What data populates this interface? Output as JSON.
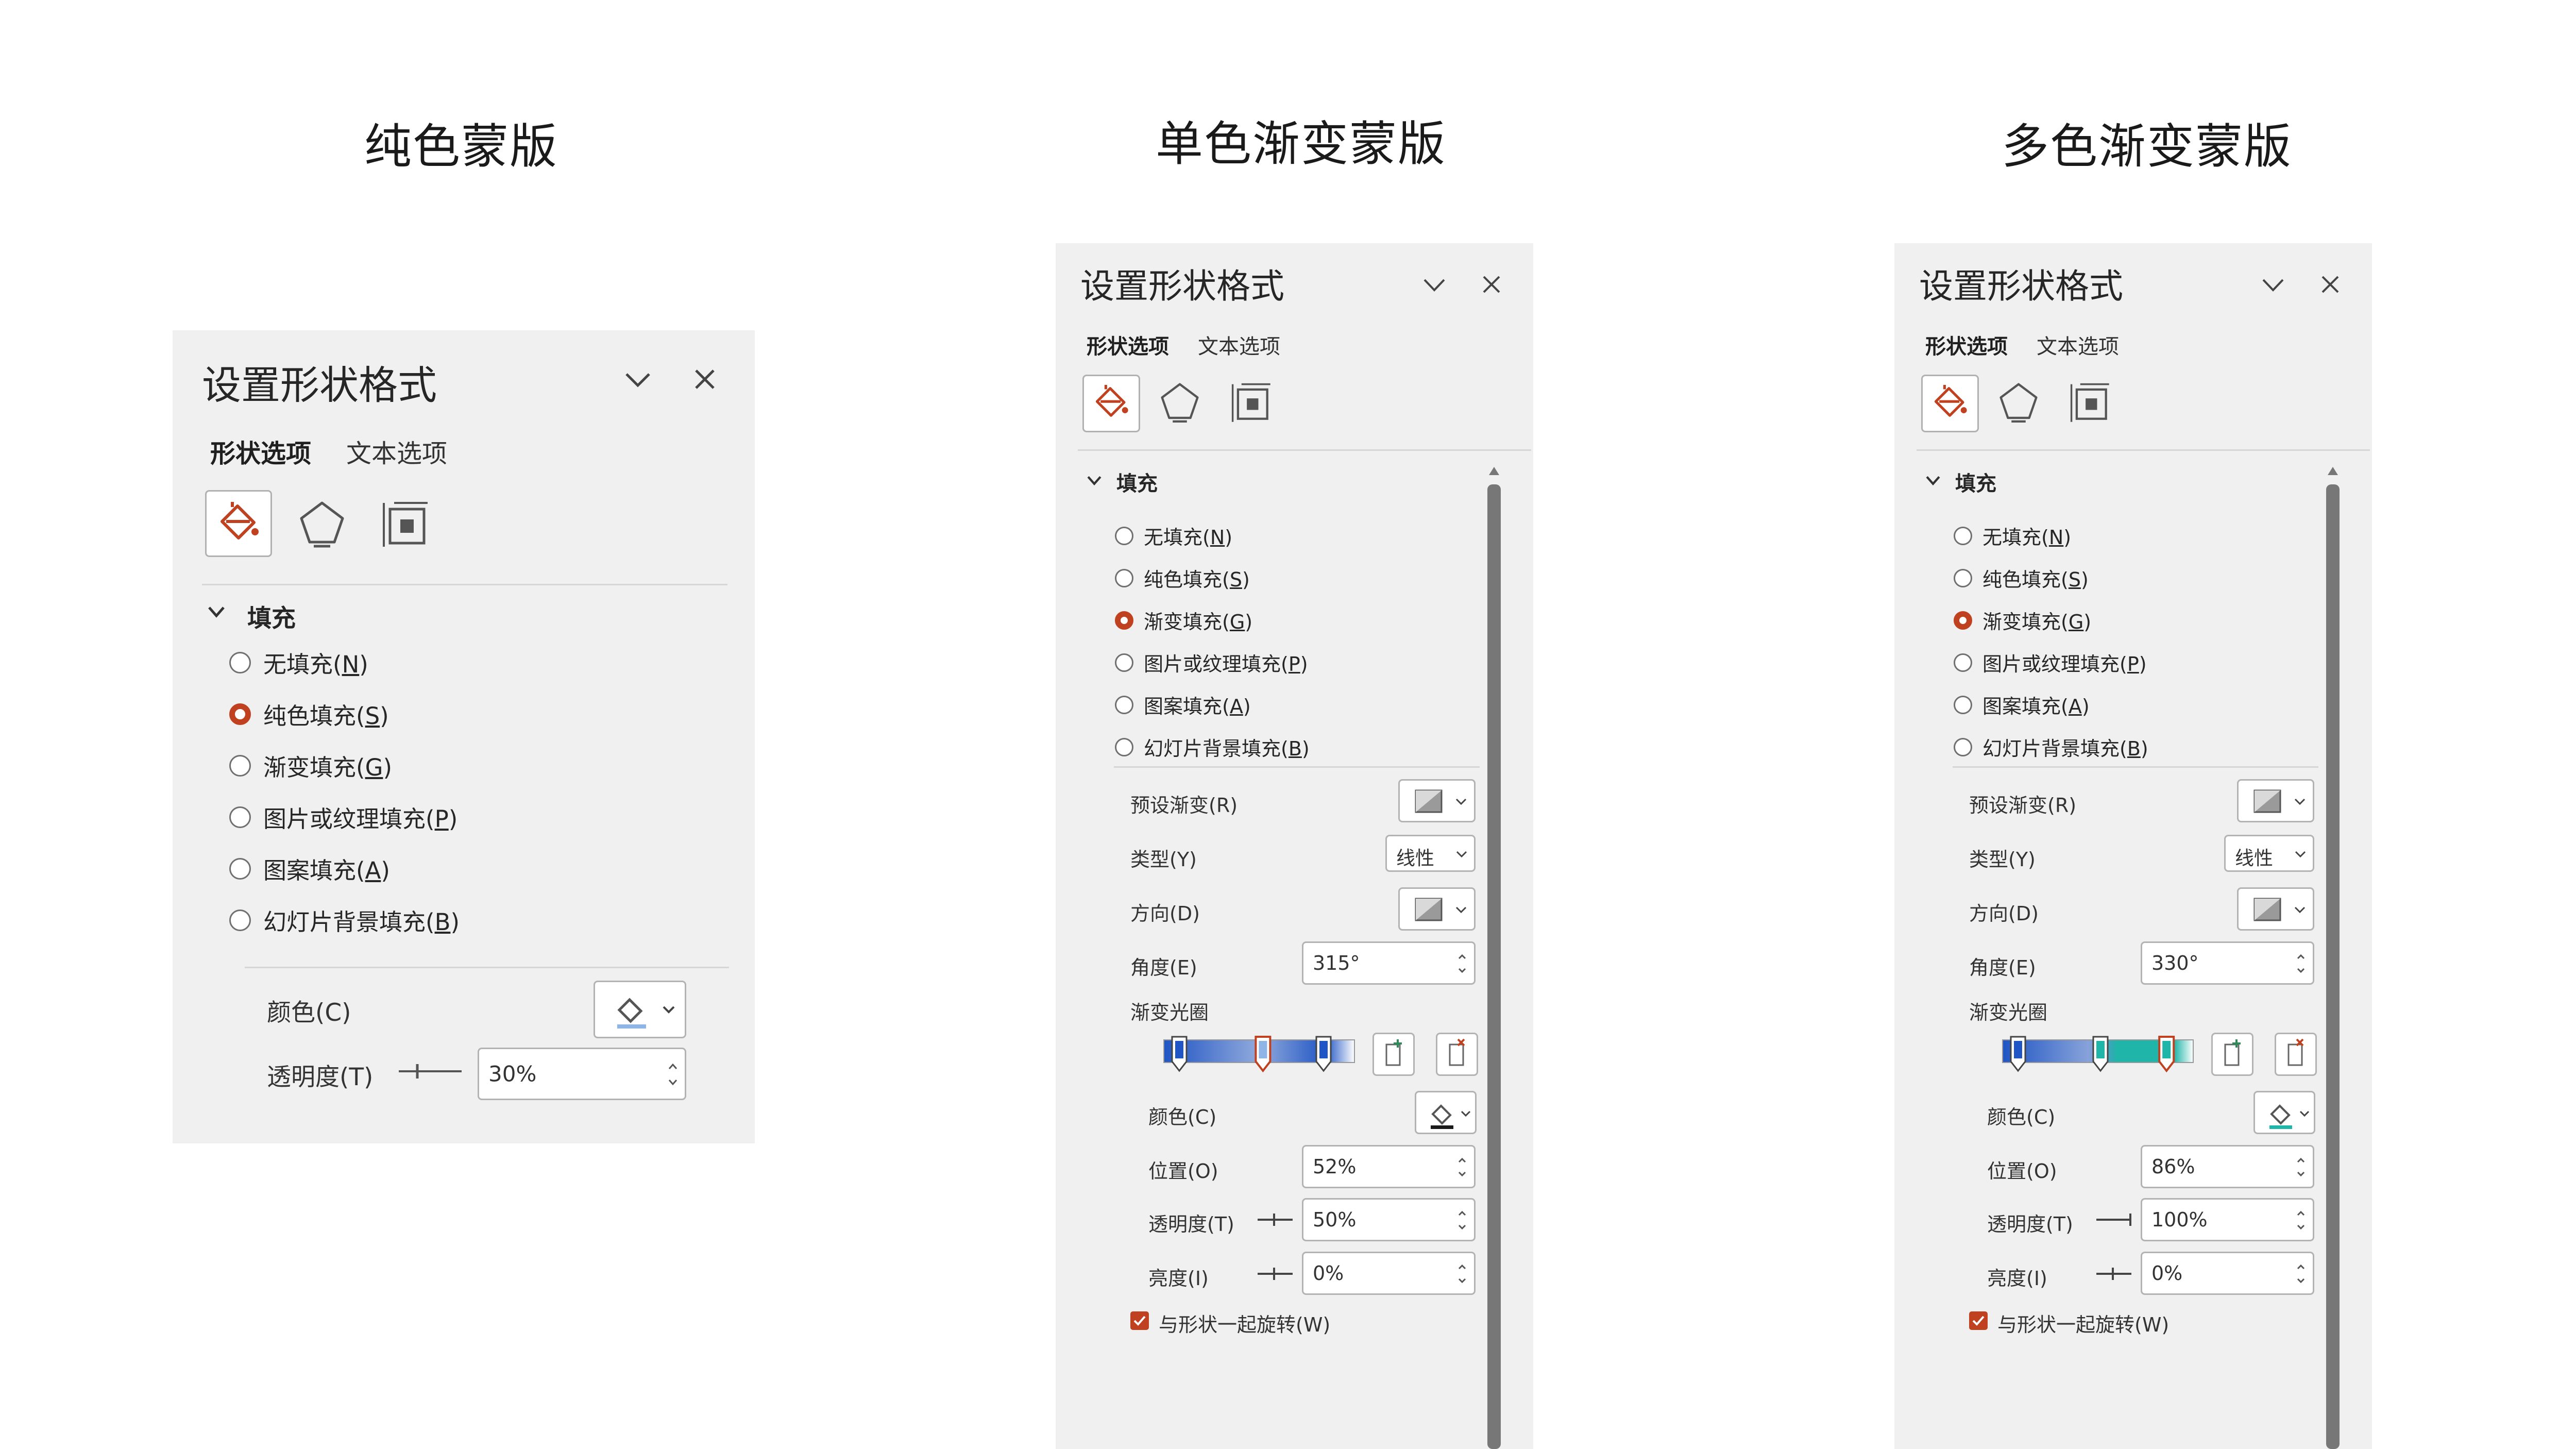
{
  "headings": {
    "solid": "纯色蒙版",
    "single_gradient": "单色渐变蒙版",
    "multi_gradient": "多色渐变蒙版"
  },
  "pane_common": {
    "title": "设置形状格式",
    "tab_shape": "形状选项",
    "tab_text": "文本选项",
    "section_fill": "填充",
    "fill_options": [
      {
        "text": "无填充(",
        "key": "N",
        "end": ")"
      },
      {
        "text": "纯色填充(",
        "key": "S",
        "end": ")"
      },
      {
        "text": "渐变填充(",
        "key": "G",
        "end": ")"
      },
      {
        "text": "图片或纹理填充(",
        "key": "P",
        "end": ")"
      },
      {
        "text": "图案填充(",
        "key": "A",
        "end": ")"
      },
      {
        "text": "幻灯片背景填充(",
        "key": "B",
        "end": ")"
      }
    ],
    "labels": {
      "color": "颜色(C)",
      "transparency": "透明度(T)",
      "preset": "预设渐变(R)",
      "type": "类型(Y)",
      "direction": "方向(D)",
      "angle": "角度(E)",
      "stops": "渐变光圈",
      "position": "位置(O)",
      "brightness": "亮度(I)",
      "rotate": "与形状一起旋转(W)"
    }
  },
  "pane1": {
    "selected_fill": "纯色填充",
    "transparency": "30%"
  },
  "pane2": {
    "selected_fill": "渐变填充",
    "type": "线性",
    "angle": "315°",
    "position": "52%",
    "transparency": "50%",
    "brightness": "0%",
    "rotate_checked": true,
    "stop_color": "#1f55c4",
    "stop_selected_position": 0.52
  },
  "pane3": {
    "selected_fill": "渐变填充",
    "type": "线性",
    "angle": "330°",
    "position": "86%",
    "transparency": "100%",
    "brightness": "0%",
    "rotate_checked": true,
    "stop_colors": [
      "#1f55c4",
      "#1fb5a8"
    ],
    "stop_selected_position": 0.86
  },
  "colors": {
    "accent": "#c0411f",
    "pane_bg": "#f0f0f0",
    "teal": "#1fb5a8"
  }
}
